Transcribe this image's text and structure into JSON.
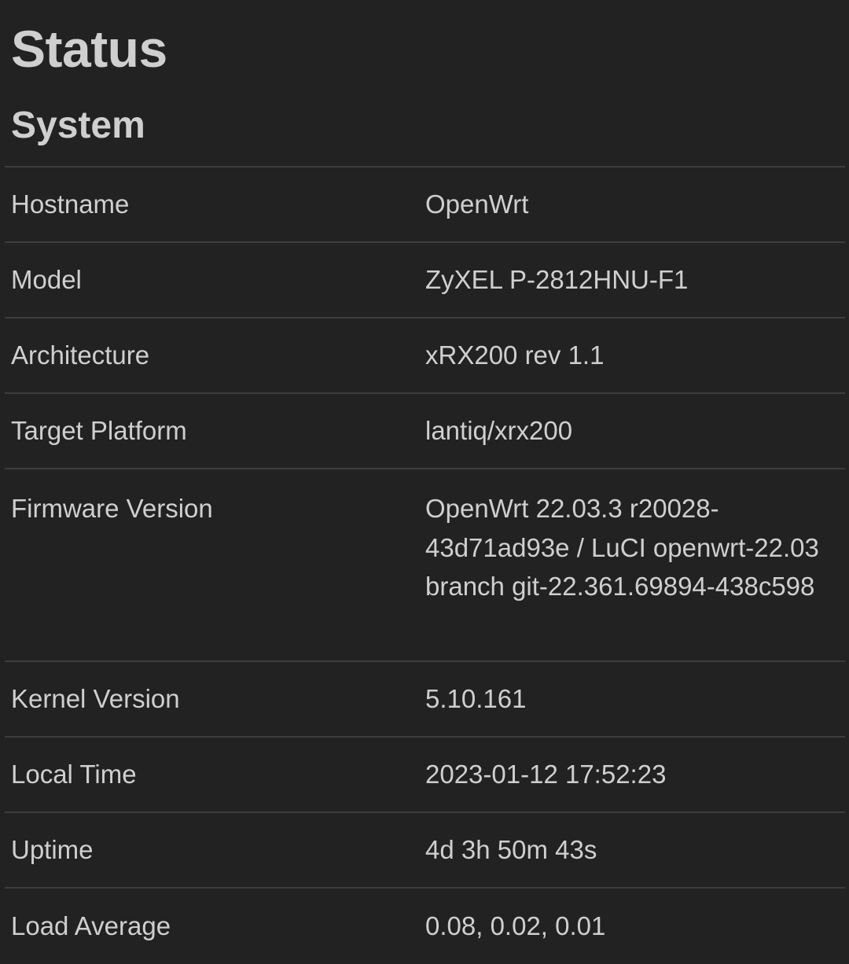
{
  "page": {
    "title": "Status"
  },
  "system": {
    "title": "System",
    "rows": [
      {
        "label": "Hostname",
        "value": "OpenWrt"
      },
      {
        "label": "Model",
        "value": "ZyXEL P-2812HNU-F1"
      },
      {
        "label": "Architecture",
        "value": "xRX200 rev 1.1"
      },
      {
        "label": "Target Platform",
        "value": "lantiq/xrx200"
      },
      {
        "label": "Firmware Version",
        "value": "OpenWrt 22.03.3 r20028-43d71ad93e / LuCI openwrt-22.03 branch git-22.361.69894-438c598"
      },
      {
        "label": "Kernel Version",
        "value": "5.10.161"
      },
      {
        "label": "Local Time",
        "value": "2023-01-12 17:52:23"
      },
      {
        "label": "Uptime",
        "value": "4d 3h 50m 43s"
      },
      {
        "label": "Load Average",
        "value": "0.08, 0.02, 0.01"
      }
    ]
  }
}
